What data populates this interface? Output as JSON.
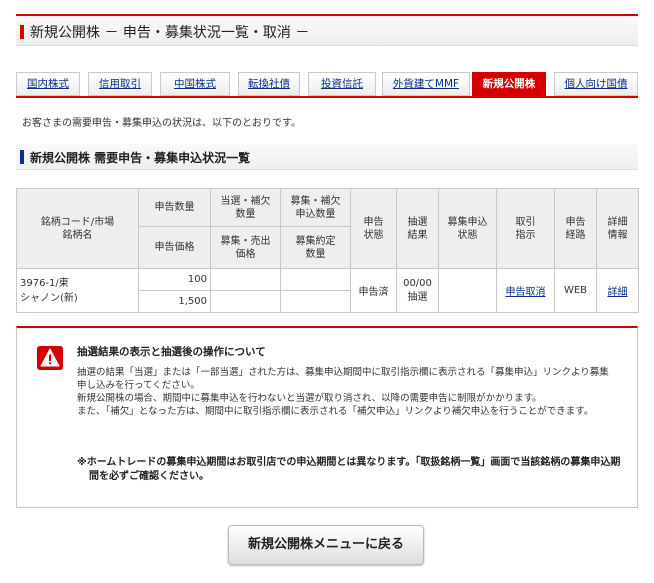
{
  "header": {
    "title": "新規公開株 － 申告・募集状況一覧・取消 －"
  },
  "tabs": [
    {
      "label": "国内株式",
      "active": false
    },
    {
      "label": "信用取引",
      "active": false
    },
    {
      "label": "中国株式",
      "active": false
    },
    {
      "label": "転換社債",
      "active": false
    },
    {
      "label": "投資信託",
      "active": false
    },
    {
      "label": "外貨建てMMF",
      "active": false
    },
    {
      "label": "新規公開株",
      "active": true
    },
    {
      "label": "個人向け国債",
      "active": false
    }
  ],
  "intro": "お客さまの需要申告・募集申込の状況は、以下のとおりです。",
  "section": {
    "title": "新規公開株 需要申告・募集申込状況一覧"
  },
  "table": {
    "headers": {
      "code": "銘柄コード/市場\n銘柄名",
      "qty": "申告数量",
      "price": "申告価格",
      "win_qty": "当選・補欠\n数量",
      "offer_price": "募集・売出\n価格",
      "apply_qty": "募集・補欠\n申込数量",
      "contract_qty": "募集約定\n数量",
      "status": "申告\n状態",
      "lottery": "抽選\n結果",
      "apply_status": "募集申込\n状態",
      "instruction": "取引\n指示",
      "route": "申告\n経路",
      "detail": "詳細\n情報"
    },
    "rows": [
      {
        "code_market": "3976-1/東",
        "name": "シャノン(新)",
        "qty": "100",
        "price": "1,500",
        "win_qty": "",
        "offer_price": "",
        "apply_qty": "",
        "contract_qty": "",
        "status": "申告済",
        "lottery": "00/00\n抽選",
        "apply_status": "",
        "instruction": "申告取消",
        "route": "WEB",
        "detail": "詳細"
      }
    ]
  },
  "notice": {
    "title": "抽選結果の表示と抽選後の操作について",
    "paragraphs": [
      "抽選の結果「当選」または「一部当選」された方は、募集申込期間中に取引指示欄に表示される「募集申込」リンクより募集申し込みを行ってください。",
      "新規公開株の場合、期間中に募集申込を行わないと当選が取り消され、以降の需要申告に制限がかかります。",
      "また、「補欠」となった方は、期間中に取引指示欄に表示される「補欠申込」リンクより補欠申込を行うことができます。"
    ],
    "note": "※ホームトレードの募集申込期間はお取引店での申込期間とは異なります。「取扱銘柄一覧」画面で当該銘柄の募集申込期間を必ずご確認ください。"
  },
  "back_button": {
    "label": "新規公開株メニューに戻る"
  },
  "colors": {
    "accent": "#d40000",
    "link": "#0b2f8a",
    "header_bg": "#eeeeee"
  }
}
